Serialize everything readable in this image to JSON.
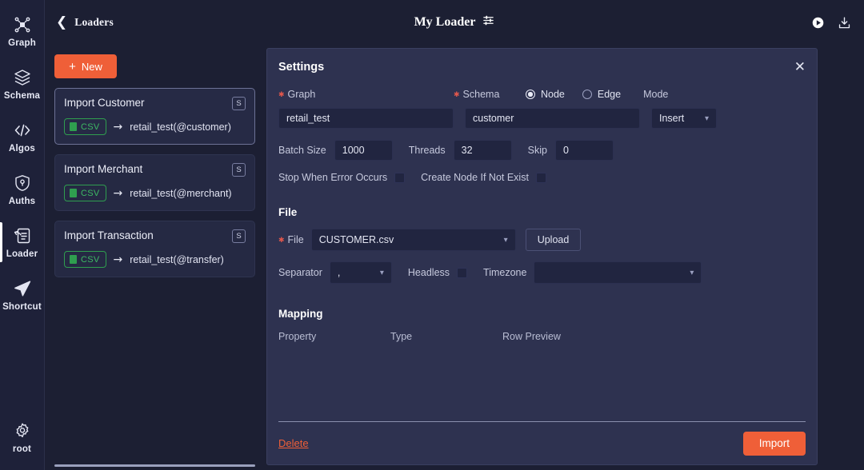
{
  "theme": {
    "bg": "#1c1f33",
    "rail_bg": "#1e2139",
    "panel_bg": "#2e3250",
    "accent": "#ef5f38",
    "green": "#2f9e4f",
    "required_star": "#e2574c"
  },
  "rail": {
    "items": [
      {
        "label": "Graph",
        "icon": "graph-nodes-icon",
        "active": false
      },
      {
        "label": "Schema",
        "icon": "layers-icon",
        "active": false
      },
      {
        "label": "Algos",
        "icon": "code-brackets-icon",
        "active": false
      },
      {
        "label": "Auths",
        "icon": "shield-key-icon",
        "active": false
      },
      {
        "label": "Loader",
        "icon": "loader-import-icon",
        "active": true
      },
      {
        "label": "Shortcut",
        "icon": "paper-plane-icon",
        "active": false
      }
    ],
    "bottom": {
      "label": "root",
      "icon": "gear-icon"
    }
  },
  "header": {
    "back_label": "Loaders",
    "back_icon": "chevron-left-icon",
    "title": "My Loader",
    "title_icon": "sliders-icon",
    "actions": [
      {
        "name": "run-icon",
        "icon": "play-circle-icon"
      },
      {
        "name": "download-icon",
        "icon": "download-icon"
      }
    ]
  },
  "loader_list": {
    "new_button": {
      "label": "New",
      "icon": "plus-icon"
    },
    "cards": [
      {
        "title": "Import Customer",
        "badge": "S",
        "format": "CSV",
        "target": "retail_test(@customer)",
        "selected": true
      },
      {
        "title": "Import Merchant",
        "badge": "S",
        "format": "CSV",
        "target": "retail_test(@merchant)",
        "selected": false
      },
      {
        "title": "Import Transaction",
        "badge": "S",
        "format": "CSV",
        "target": "retail_test(@transfer)",
        "selected": false
      }
    ]
  },
  "settings": {
    "title": "Settings",
    "close_icon": "close-icon",
    "graph": {
      "label": "Graph",
      "value": "retail_test",
      "required": true
    },
    "schema": {
      "label": "Schema",
      "value": "customer",
      "required": true
    },
    "entity": {
      "node_label": "Node",
      "edge_label": "Edge",
      "selected": "Node"
    },
    "mode": {
      "label": "Mode",
      "value": "Insert"
    },
    "batch_size": {
      "label": "Batch Size",
      "value": "1000"
    },
    "threads": {
      "label": "Threads",
      "value": "32"
    },
    "skip": {
      "label": "Skip",
      "value": "0"
    },
    "stop_on_error": {
      "label": "Stop When Error Occurs",
      "checked": false
    },
    "create_node": {
      "label": "Create Node If Not Exist",
      "checked": false
    },
    "file_section": {
      "title": "File",
      "file": {
        "label": "File",
        "value": "CUSTOMER.csv",
        "required": true
      },
      "upload_label": "Upload",
      "separator": {
        "label": "Separator",
        "value": ","
      },
      "headless": {
        "label": "Headless",
        "checked": false
      },
      "timezone": {
        "label": "Timezone",
        "value": ""
      }
    },
    "mapping_section": {
      "title": "Mapping",
      "columns": [
        "Property",
        "Type",
        "Row Preview"
      ],
      "rows": []
    },
    "footer": {
      "delete_label": "Delete",
      "import_label": "Import"
    }
  }
}
